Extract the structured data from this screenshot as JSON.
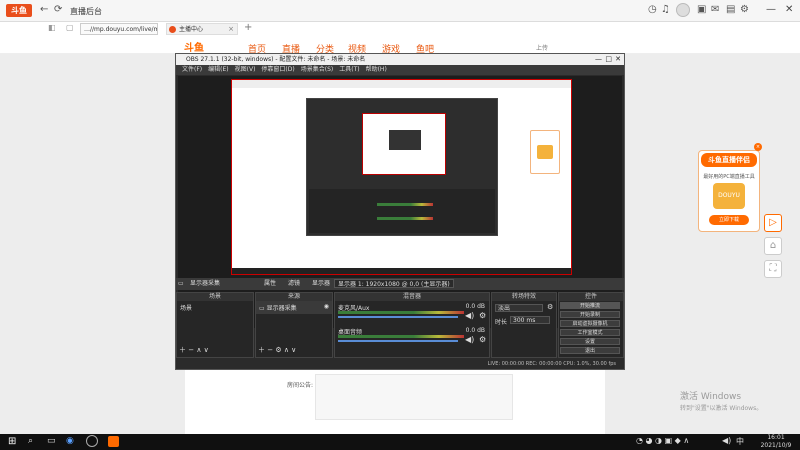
{
  "browser": {
    "title": "直播后台",
    "url": "…//mp.douyu.com/live/main",
    "tab_label": "主播中心",
    "new_tab": "+",
    "logo_text": "斗鱼"
  },
  "site_nav": {
    "brand": "斗鱼",
    "items": [
      "首页",
      "直播",
      "分类",
      "视频",
      "游戏",
      "鱼吧"
    ],
    "user_button": "上传"
  },
  "obs": {
    "title": "OBS 27.1.1 (32-bit, windows) - 配置文件: 未命名 - 场景: 未命名",
    "menu": [
      "文件(F)",
      "编辑(E)",
      "视图(V)",
      "停靠窗口(D)",
      "场景集合(S)",
      "工具(T)",
      "帮助(H)"
    ],
    "preview_controls": {
      "display_label": "显示器采集",
      "properties": "属性",
      "filters": "滤镜",
      "display": "显示器",
      "display_value": "显示器 1: 1920x1080 @ 0,0 (主显示器)"
    },
    "docks": {
      "scenes": {
        "header": "场景",
        "items": [
          "场景"
        ]
      },
      "sources": {
        "header": "来源",
        "items": [
          "显示器采集"
        ]
      },
      "mixer": {
        "header": "混音器",
        "channels": [
          {
            "name": "麦克风/Aux",
            "db": "0.0 dB"
          },
          {
            "name": "桌面音频",
            "db": "0.0 dB"
          }
        ]
      },
      "transitions": {
        "header": "转场特效",
        "type": "淡出",
        "duration_label": "时长",
        "duration_value": "300 ms"
      },
      "controls": {
        "header": "控件",
        "buttons": [
          "开始推流",
          "开始录制",
          "启动虚拟摄像机",
          "工作室模式",
          "设置",
          "退出"
        ]
      }
    },
    "status": "LIVE: 00:00:00   REC: 00:00:00   CPU: 1.0%, 30.00 fps"
  },
  "ad": {
    "title": "斗鱼直播伴侣",
    "subtitle": "最好用的PC端直播工具",
    "image_label": "DOUYU",
    "button": "立即下载"
  },
  "windows_watermark": {
    "line1": "激活 Windows",
    "line2": "转到\"设置\"以激活 Windows。"
  },
  "page_label": "房间公告:",
  "taskbar": {
    "time": "16:01",
    "date": "2021/10/9"
  },
  "colors": {
    "accent": "#ff6a00",
    "obs_bg": "#2b2b2b",
    "taskbar": "#101010"
  }
}
